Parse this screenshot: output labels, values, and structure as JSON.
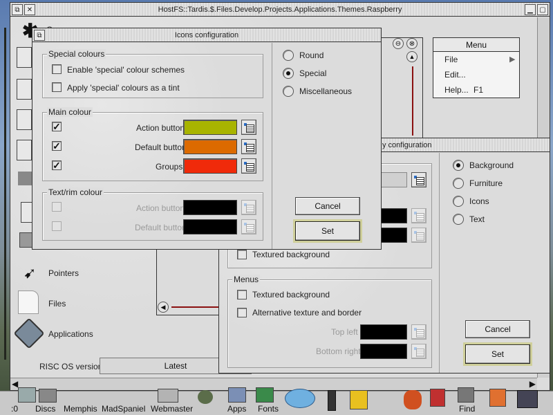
{
  "filer": {
    "title": "HostFS::Tardis.$.Files.Develop.Projects.Applications.Themes.Raspberry",
    "items": [
      {
        "label": "Pointers",
        "icon": "pointer-icon"
      },
      {
        "label": "Files",
        "icon": "file-icon"
      },
      {
        "label": "Applications",
        "icon": "app-icon"
      }
    ],
    "partial_label": "G",
    "os_version_label": "RISC OS version",
    "os_version_value": "Latest"
  },
  "icons_dialog": {
    "title": "Icons configuration",
    "special_colours": {
      "heading": "Special colours",
      "options": [
        {
          "label": "Enable 'special' colour schemes",
          "checked": false
        },
        {
          "label": "Apply 'special' colours as a tint",
          "checked": false
        }
      ]
    },
    "main_colour": {
      "heading": "Main colour",
      "rows": [
        {
          "label": "Action button",
          "checked": true,
          "color": "#a8b400"
        },
        {
          "label": "Default button",
          "checked": true,
          "color": "#dc6a00"
        },
        {
          "label": "Groups",
          "checked": true,
          "color": "#f02a0a"
        }
      ]
    },
    "text_rim_colour": {
      "heading": "Text/rim colour",
      "rows": [
        {
          "label": "Action button",
          "color": "#000000"
        },
        {
          "label": "Default button",
          "color": "#000000"
        }
      ]
    },
    "styles": [
      {
        "label": "Round",
        "selected": false
      },
      {
        "label": "Special",
        "selected": true
      },
      {
        "label": "Miscellaneous",
        "selected": false
      }
    ],
    "cancel_label": "Cancel",
    "set_label": "Set"
  },
  "menu": {
    "title": "Menu",
    "items": [
      {
        "label": "File",
        "shortcut": "",
        "submenu": true
      },
      {
        "label": "Edit...",
        "shortcut": "",
        "submenu": false
      },
      {
        "label": "Help...",
        "shortcut": "F1",
        "submenu": false
      }
    ]
  },
  "window_dialog": {
    "title_partial": "y configuration",
    "sections": [
      {
        "label": "Background",
        "selected": true
      },
      {
        "label": "Furniture",
        "selected": false
      },
      {
        "label": "Icons",
        "selected": false
      },
      {
        "label": "Text",
        "selected": false
      }
    ],
    "textured_background_label": "Textured background",
    "menus": {
      "heading": "Menus",
      "textured_background_label": "Textured background",
      "alt_texture_label": "Alternative texture and border",
      "top_left_label": "Top left",
      "bottom_right_label": "Bottom right"
    },
    "cancel_label": "Cancel",
    "set_label": "Set"
  },
  "iconbar": {
    "items": [
      {
        "label": ":0"
      },
      {
        "label": "Discs"
      },
      {
        "label": "Memphis"
      },
      {
        "label": "MadSpaniel"
      },
      {
        "label": "Webmaster"
      },
      {
        "label": "Apps"
      },
      {
        "label": "Fonts"
      },
      {
        "label": "Find"
      }
    ]
  }
}
